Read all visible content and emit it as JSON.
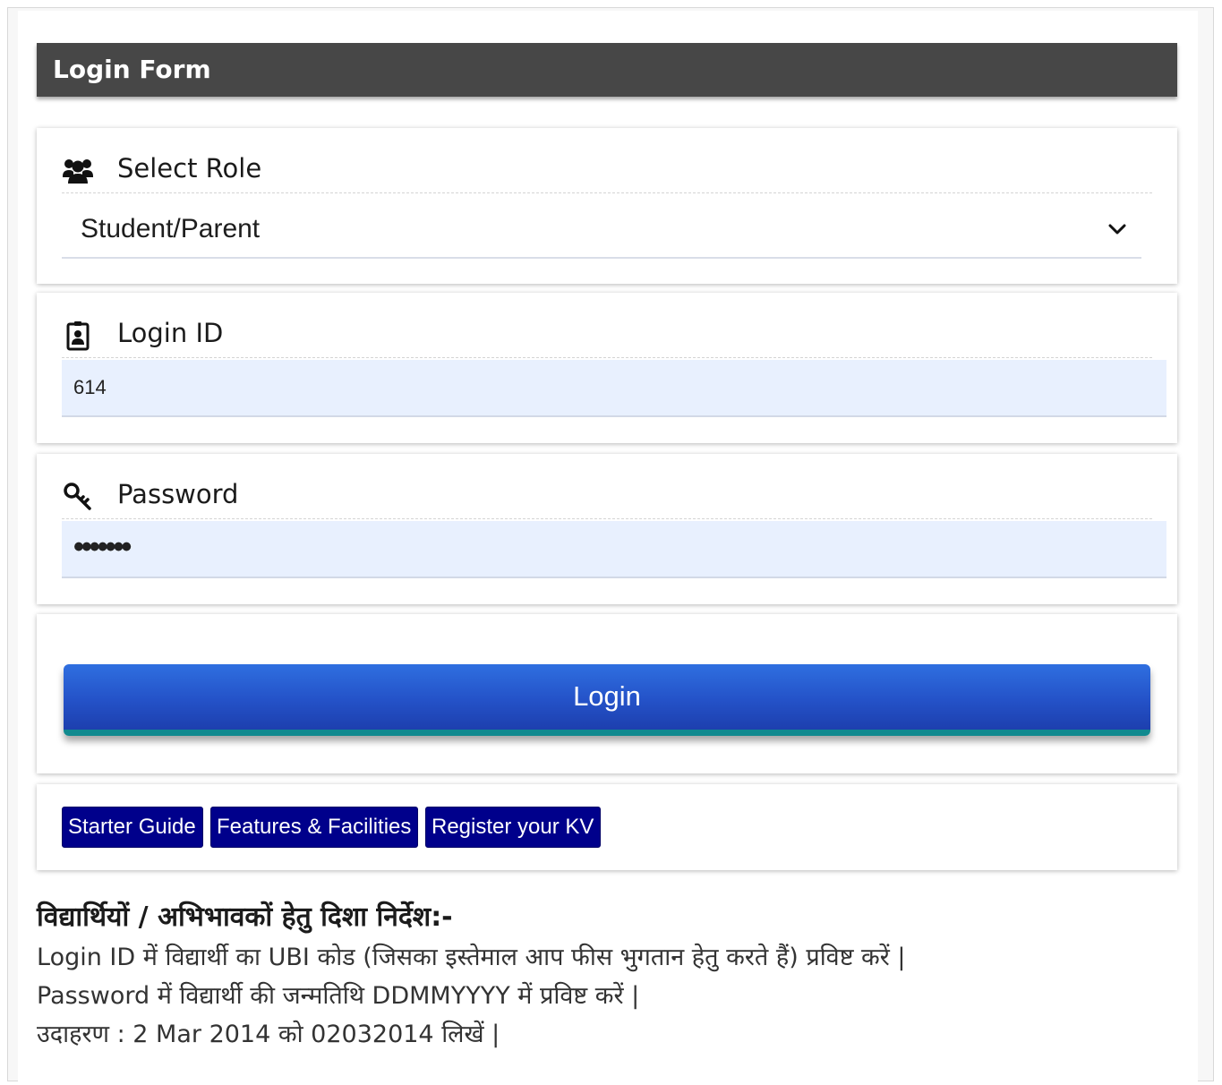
{
  "header": {
    "title": "Login Form"
  },
  "role": {
    "label": "Select Role",
    "icon": "users-icon",
    "selected": "Student/Parent"
  },
  "login_id": {
    "label": "Login ID",
    "icon": "id-badge-icon",
    "value": "614"
  },
  "password": {
    "label": "Password",
    "icon": "key-icon",
    "masked_value": "•••••••"
  },
  "login_button": {
    "label": "Login"
  },
  "links": {
    "starter_guide": "Starter Guide",
    "features": "Features & Facilities",
    "register": "Register your KV"
  },
  "instructions": {
    "heading": "विद्यार्थियों / अभिभावकों हेतु दिशा निर्देश:-",
    "line1": "Login ID में विद्यार्थी का UBI कोड (जिसका इस्तेमाल आप फीस भुगतान हेतु करते हैं) प्रविष्ट करें |",
    "line2": "Password में विद्यार्थी की जन्मतिथि DDMMYYYY में प्रविष्ट करें |",
    "line3": "उदाहरण : 2 Mar 2014 को 02032014 लिखें |"
  },
  "colors": {
    "header_bg": "#474747",
    "input_bg": "#e8f0fe",
    "login_button": "#2452c8",
    "link_button": "#00008b"
  }
}
